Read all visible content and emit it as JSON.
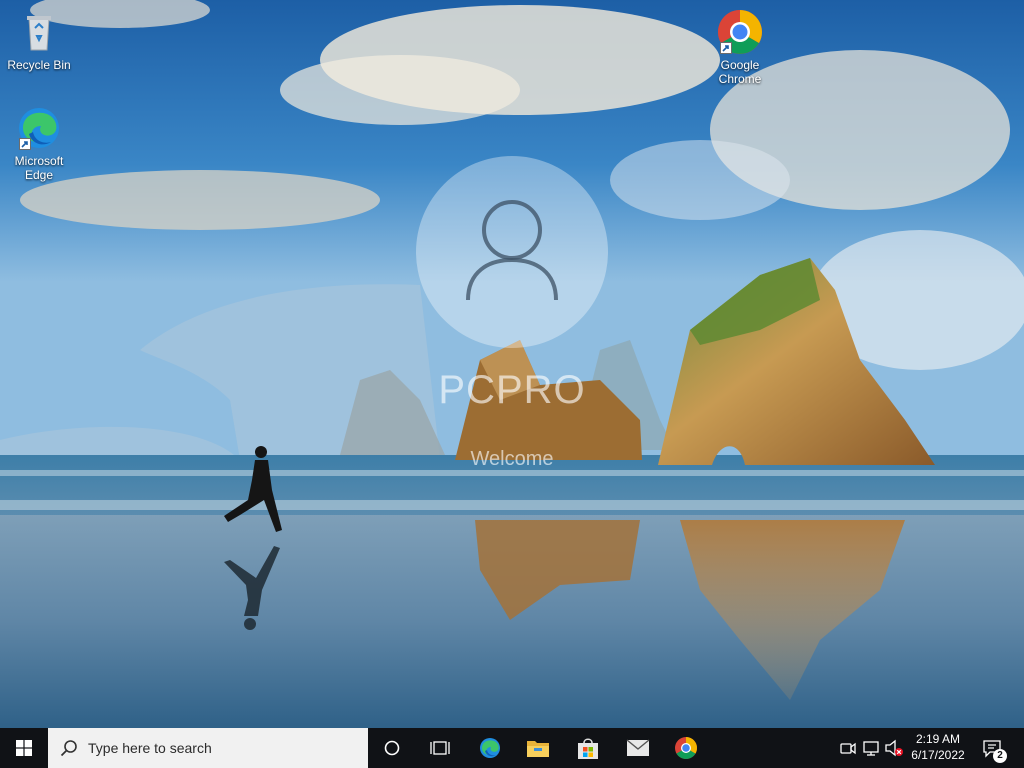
{
  "desktop": {
    "icons": [
      {
        "label": "Recycle Bin",
        "icon": "recycle-bin-icon"
      },
      {
        "label": "Microsoft Edge",
        "icon": "edge-icon"
      },
      {
        "label": "Google Chrome",
        "icon": "chrome-icon"
      }
    ]
  },
  "welcome": {
    "user_name": "PCPRO",
    "message": "Welcome",
    "avatar_icon": "user-avatar-icon"
  },
  "taskbar": {
    "search_placeholder": "Type here to search",
    "clock_time": "2:19 AM",
    "clock_date": "6/17/2022",
    "notification_count": "2",
    "pinned": [
      "cortana-icon",
      "task-view-icon",
      "edge-icon",
      "file-explorer-icon",
      "microsoft-store-icon",
      "mail-icon",
      "chrome-icon"
    ],
    "tray": [
      "meet-now-icon",
      "network-icon",
      "volume-muted-icon",
      "action-center-icon"
    ]
  },
  "colors": {
    "taskbar": "#101216",
    "search_box": "#f1f1f1",
    "sky_top": "#1a5aa0",
    "sea": "#3b7aa3",
    "sand": "#6f94ad"
  }
}
